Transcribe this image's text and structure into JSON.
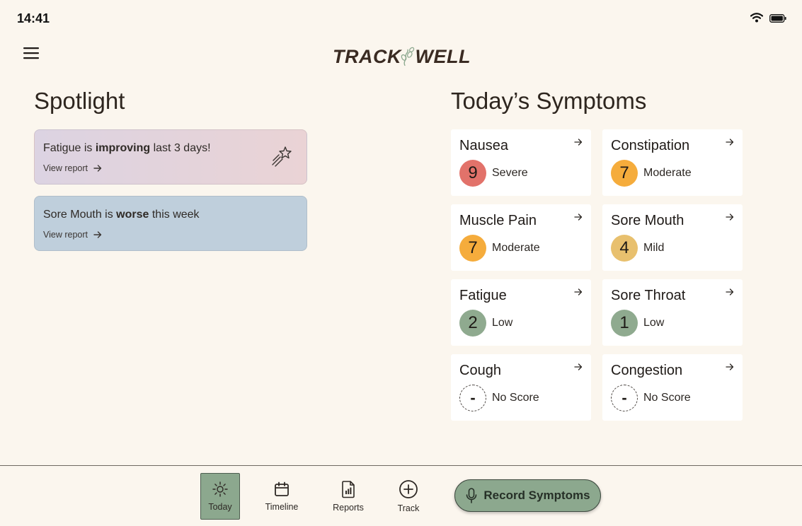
{
  "status": {
    "time": "14:41"
  },
  "header": {
    "logo_part1": "TRACK",
    "logo_part2": "WELL"
  },
  "spotlight": {
    "title": "Spotlight",
    "cards": [
      {
        "pre": "Fatigue is ",
        "bold": "improving",
        "post": " last 3 days!",
        "link": "View report",
        "bg": "#E2D3DC"
      },
      {
        "pre": "Sore Mouth is ",
        "bold": "worse",
        "post": " this week",
        "link": "View report",
        "bg": "#BFCFDC"
      }
    ]
  },
  "symptoms": {
    "title": "Today’s Symptoms",
    "items": [
      {
        "name": "Nausea",
        "score": "9",
        "level": "Severe",
        "color": "#E2726A"
      },
      {
        "name": "Constipation",
        "score": "7",
        "level": "Moderate",
        "color": "#F5AC3C"
      },
      {
        "name": "Muscle Pain",
        "score": "7",
        "level": "Moderate",
        "color": "#F5AC3C"
      },
      {
        "name": "Sore Mouth",
        "score": "4",
        "level": "Mild",
        "color": "#E8C06E"
      },
      {
        "name": "Fatigue",
        "score": "2",
        "level": "Low",
        "color": "#8FAA8F"
      },
      {
        "name": "Sore Throat",
        "score": "1",
        "level": "Low",
        "color": "#8FAA8F"
      },
      {
        "name": "Cough",
        "score": "-",
        "level": "No Score",
        "color": "none"
      },
      {
        "name": "Congestion",
        "score": "-",
        "level": "No Score",
        "color": "none"
      }
    ]
  },
  "nav": {
    "items": [
      {
        "label": "Today",
        "icon": "sun-icon",
        "active": true
      },
      {
        "label": "Timeline",
        "icon": "calendar-icon",
        "active": false
      },
      {
        "label": "Reports",
        "icon": "report-icon",
        "active": false
      },
      {
        "label": "Track",
        "icon": "plus-circle-icon",
        "active": false
      }
    ],
    "record_label": "Record Symptoms"
  }
}
